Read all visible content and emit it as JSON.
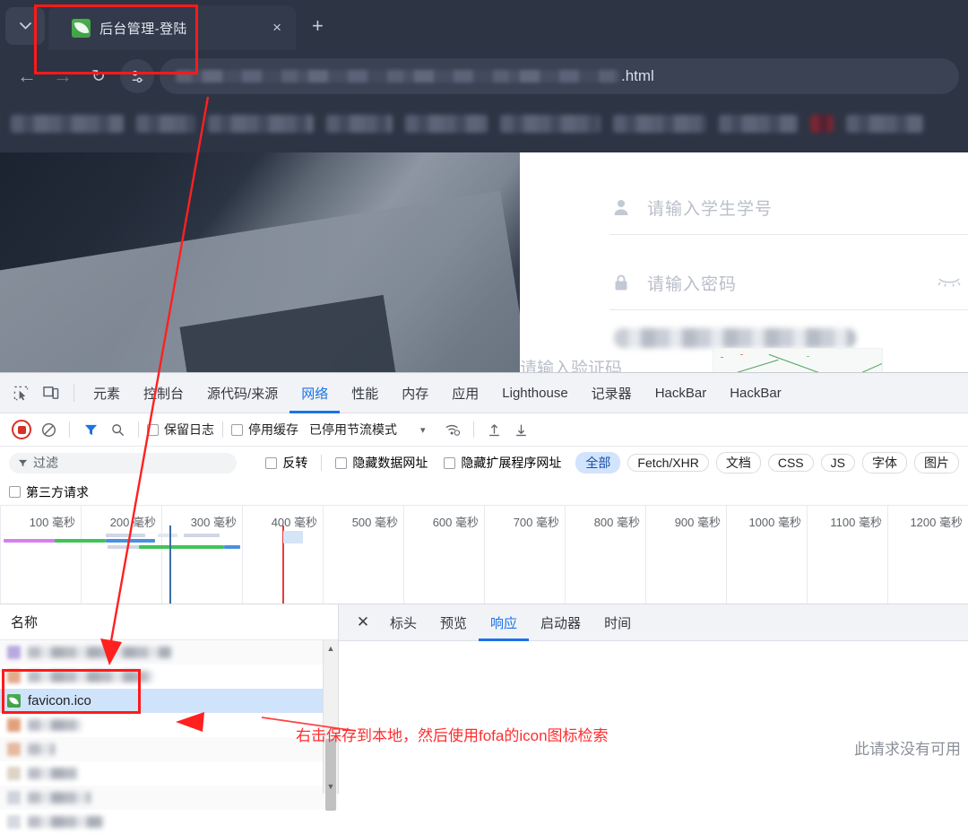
{
  "browser": {
    "tab": {
      "title": "后台管理-登陆",
      "favicon": "leaf-icon",
      "close_label": "×"
    },
    "new_tab_label": "+",
    "tab_search_label": "⌄",
    "nav": {
      "back": "←",
      "forward": "→",
      "reload": "↻"
    },
    "omnibox": {
      "url_tail": ".html",
      "site_info_icon": "tune-icon"
    }
  },
  "login_page": {
    "username": {
      "placeholder": "请输入学生学号",
      "icon": "user-icon"
    },
    "password": {
      "placeholder": "请输入密码",
      "icon": "lock-icon",
      "toggle_icon": "eye-closed-icon"
    },
    "captcha": {
      "placeholder": "请输入验证码",
      "image_alt": "captcha-image"
    }
  },
  "devtools": {
    "tools": [
      {
        "label": "元素",
        "active": false
      },
      {
        "label": "控制台",
        "active": false
      },
      {
        "label": "源代码/来源",
        "active": false
      },
      {
        "label": "网络",
        "active": true
      },
      {
        "label": "性能",
        "active": false
      },
      {
        "label": "内存",
        "active": false
      },
      {
        "label": "应用",
        "active": false
      },
      {
        "label": "Lighthouse",
        "active": false
      },
      {
        "label": "记录器",
        "active": false
      },
      {
        "label": "HackBar",
        "active": false
      },
      {
        "label": "HackBar",
        "active": false
      }
    ],
    "icons": {
      "inspect": "inspect-element-icon",
      "device": "device-toolbar-icon"
    },
    "network_toolbar": {
      "record": "record-button",
      "clear": "clear-icon",
      "filter_toggle": "filter-icon",
      "search": "search-icon",
      "preserve_log": "保留日志",
      "disable_cache": "停用缓存",
      "throttling": "已停用节流模式",
      "throttling_caret": "▾",
      "wifi": "network-conditions-icon",
      "import": "import-har-icon",
      "export": "export-har-icon"
    },
    "filter_bar": {
      "placeholder": "过滤",
      "invert": "反转",
      "hide_data_urls": "隐藏数据网址",
      "hide_ext_urls": "隐藏扩展程序网址",
      "third_party": "第三方请求",
      "chips": [
        {
          "label": "全部",
          "active": true
        },
        {
          "label": "Fetch/XHR",
          "active": false
        },
        {
          "label": "文档",
          "active": false
        },
        {
          "label": "CSS",
          "active": false
        },
        {
          "label": "JS",
          "active": false
        },
        {
          "label": "字体",
          "active": false
        },
        {
          "label": "图片",
          "active": false
        }
      ]
    },
    "overview": {
      "ticks": [
        "100 毫秒",
        "200 毫秒",
        "300 毫秒",
        "400 毫秒",
        "500 毫秒",
        "600 毫秒",
        "700 毫秒",
        "800 毫秒",
        "900 毫秒",
        "1000 毫秒",
        "1100 毫秒",
        "1200 毫秒"
      ]
    },
    "request_list": {
      "column_header": "名称",
      "rows": [
        {
          "name": "",
          "redacted": true,
          "selected": false,
          "icon": "generic-icon"
        },
        {
          "name": "",
          "redacted": true,
          "selected": false,
          "icon": "generic-icon"
        },
        {
          "name": "favicon.ico",
          "redacted": false,
          "selected": true,
          "icon": "leaf-icon"
        },
        {
          "name": "",
          "redacted": true,
          "selected": false,
          "icon": "generic-icon"
        },
        {
          "name": "",
          "redacted": true,
          "selected": false,
          "icon": "generic-icon"
        },
        {
          "name": "",
          "redacted": true,
          "selected": false,
          "icon": "generic-icon"
        },
        {
          "name": "",
          "redacted": true,
          "selected": false,
          "icon": "generic-icon"
        }
      ]
    },
    "detail": {
      "close": "✕",
      "tabs": [
        {
          "label": "标头",
          "active": false
        },
        {
          "label": "预览",
          "active": false
        },
        {
          "label": "响应",
          "active": true
        },
        {
          "label": "启动器",
          "active": false
        },
        {
          "label": "时间",
          "active": false
        }
      ],
      "empty_message": "此请求没有可用"
    }
  },
  "annotations": {
    "tip_text": "右击保存到本地，然后使用fofa的icon图标检索",
    "color": "#ff2d2d"
  }
}
